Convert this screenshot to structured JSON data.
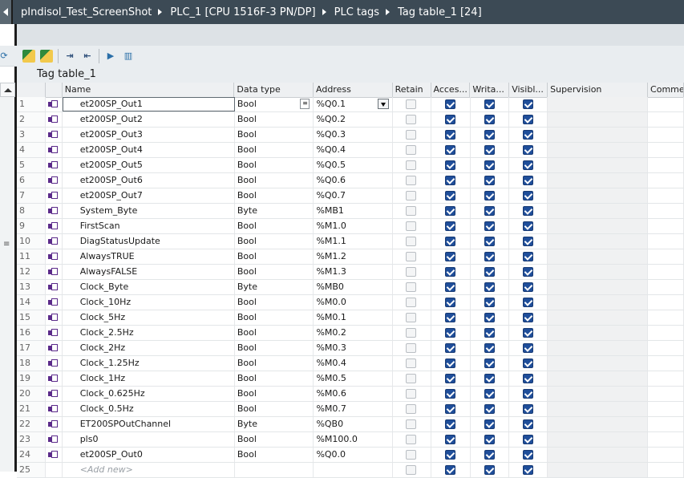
{
  "breadcrumb": [
    "pIndisol_Test_ScreenShot",
    "PLC_1 [CPU 1516F-3 PN/DP]",
    "PLC tags",
    "Tag table_1 [24]"
  ],
  "toolbar": {
    "icons": [
      "add-tag-icon",
      "insert-row-icon",
      "export-icon",
      "import-icon",
      "monitor-icon",
      "snapshot-icon"
    ]
  },
  "table_title": "Tag table_1",
  "columns": [
    "Name",
    "Data type",
    "Address",
    "Retain",
    "Acces...",
    "Writa...",
    "Visibl...",
    "Supervision",
    "Commer"
  ],
  "rows": [
    {
      "n": "1",
      "name": "et200SP_Out1",
      "type": "Bool",
      "addr": "%Q0.1",
      "retain": false,
      "acc": true,
      "wri": true,
      "vis": true
    },
    {
      "n": "2",
      "name": "et200SP_Out2",
      "type": "Bool",
      "addr": "%Q0.2",
      "retain": false,
      "acc": true,
      "wri": true,
      "vis": true
    },
    {
      "n": "3",
      "name": "et200SP_Out3",
      "type": "Bool",
      "addr": "%Q0.3",
      "retain": false,
      "acc": true,
      "wri": true,
      "vis": true
    },
    {
      "n": "4",
      "name": "et200SP_Out4",
      "type": "Bool",
      "addr": "%Q0.4",
      "retain": false,
      "acc": true,
      "wri": true,
      "vis": true
    },
    {
      "n": "5",
      "name": "et200SP_Out5",
      "type": "Bool",
      "addr": "%Q0.5",
      "retain": false,
      "acc": true,
      "wri": true,
      "vis": true
    },
    {
      "n": "6",
      "name": "et200SP_Out6",
      "type": "Bool",
      "addr": "%Q0.6",
      "retain": false,
      "acc": true,
      "wri": true,
      "vis": true
    },
    {
      "n": "7",
      "name": "et200SP_Out7",
      "type": "Bool",
      "addr": "%Q0.7",
      "retain": false,
      "acc": true,
      "wri": true,
      "vis": true
    },
    {
      "n": "8",
      "name": "System_Byte",
      "type": "Byte",
      "addr": "%MB1",
      "retain": false,
      "acc": true,
      "wri": true,
      "vis": true
    },
    {
      "n": "9",
      "name": "FirstScan",
      "type": "Bool",
      "addr": "%M1.0",
      "retain": false,
      "acc": true,
      "wri": true,
      "vis": true
    },
    {
      "n": "10",
      "name": "DiagStatusUpdate",
      "type": "Bool",
      "addr": "%M1.1",
      "retain": false,
      "acc": true,
      "wri": true,
      "vis": true
    },
    {
      "n": "11",
      "name": "AlwaysTRUE",
      "type": "Bool",
      "addr": "%M1.2",
      "retain": false,
      "acc": true,
      "wri": true,
      "vis": true
    },
    {
      "n": "12",
      "name": "AlwaysFALSE",
      "type": "Bool",
      "addr": "%M1.3",
      "retain": false,
      "acc": true,
      "wri": true,
      "vis": true
    },
    {
      "n": "13",
      "name": "Clock_Byte",
      "type": "Byte",
      "addr": "%MB0",
      "retain": false,
      "acc": true,
      "wri": true,
      "vis": true
    },
    {
      "n": "14",
      "name": "Clock_10Hz",
      "type": "Bool",
      "addr": "%M0.0",
      "retain": false,
      "acc": true,
      "wri": true,
      "vis": true
    },
    {
      "n": "15",
      "name": "Clock_5Hz",
      "type": "Bool",
      "addr": "%M0.1",
      "retain": false,
      "acc": true,
      "wri": true,
      "vis": true
    },
    {
      "n": "16",
      "name": "Clock_2.5Hz",
      "type": "Bool",
      "addr": "%M0.2",
      "retain": false,
      "acc": true,
      "wri": true,
      "vis": true
    },
    {
      "n": "17",
      "name": "Clock_2Hz",
      "type": "Bool",
      "addr": "%M0.3",
      "retain": false,
      "acc": true,
      "wri": true,
      "vis": true
    },
    {
      "n": "18",
      "name": "Clock_1.25Hz",
      "type": "Bool",
      "addr": "%M0.4",
      "retain": false,
      "acc": true,
      "wri": true,
      "vis": true
    },
    {
      "n": "19",
      "name": "Clock_1Hz",
      "type": "Bool",
      "addr": "%M0.5",
      "retain": false,
      "acc": true,
      "wri": true,
      "vis": true
    },
    {
      "n": "20",
      "name": "Clock_0.625Hz",
      "type": "Bool",
      "addr": "%M0.6",
      "retain": false,
      "acc": true,
      "wri": true,
      "vis": true
    },
    {
      "n": "21",
      "name": "Clock_0.5Hz",
      "type": "Bool",
      "addr": "%M0.7",
      "retain": false,
      "acc": true,
      "wri": true,
      "vis": true
    },
    {
      "n": "22",
      "name": "ET200SPOutChannel",
      "type": "Byte",
      "addr": "%QB0",
      "retain": false,
      "acc": true,
      "wri": true,
      "vis": true
    },
    {
      "n": "23",
      "name": "pls0",
      "type": "Bool",
      "addr": "%M100.0",
      "retain": false,
      "acc": true,
      "wri": true,
      "vis": true
    },
    {
      "n": "24",
      "name": "et200SP_Out0",
      "type": "Bool",
      "addr": "%Q0.0",
      "retain": false,
      "acc": true,
      "wri": true,
      "vis": true
    },
    {
      "n": "25",
      "name": "<Add new>",
      "type": "",
      "addr": "",
      "retain": false,
      "acc": true,
      "wri": true,
      "vis": true
    }
  ]
}
